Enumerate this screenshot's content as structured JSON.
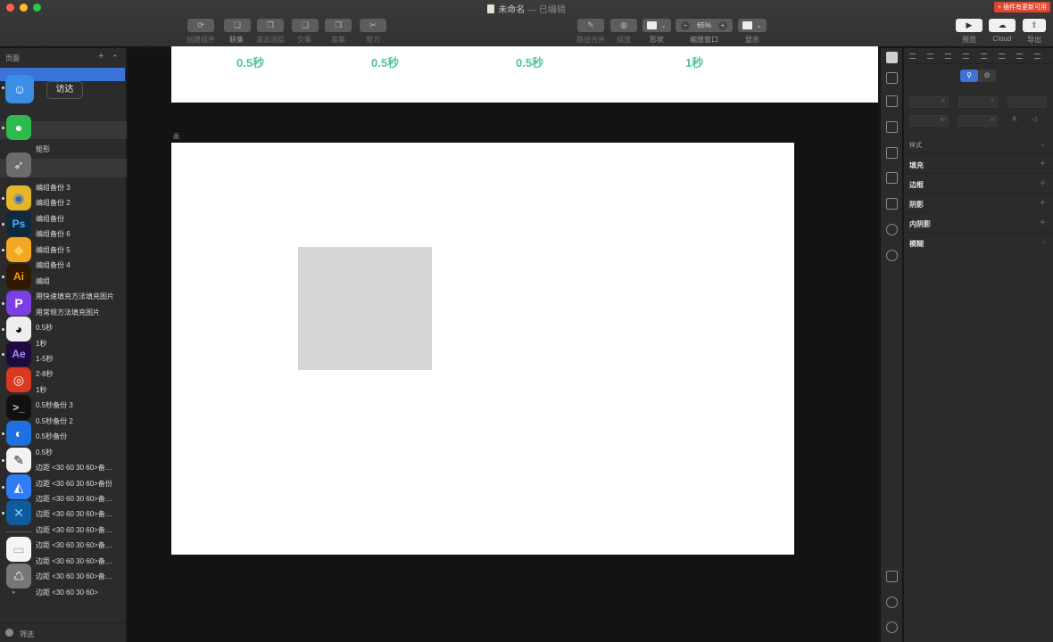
{
  "window": {
    "title": "未命名",
    "subtitle": "— 已编辑",
    "update_badge": "+ 插件有更新可用"
  },
  "toolbar": {
    "items": [
      {
        "label": "创建组件",
        "icon": "component-icon"
      },
      {
        "label": "联集",
        "icon": "union-icon"
      },
      {
        "label": "减去顶层",
        "icon": "subtract-icon"
      },
      {
        "label": "交集",
        "icon": "intersect-icon"
      },
      {
        "label": "差集",
        "icon": "difference-icon"
      },
      {
        "label": "剪刀",
        "icon": "scissors-icon"
      },
      {
        "label": "路径合并",
        "icon": "path-merge-icon"
      },
      {
        "label": "描放",
        "icon": "scale-icon"
      },
      {
        "label": "形状",
        "icon": "shape-icon"
      },
      {
        "label": "缩放窗口",
        "icon": "zoom-icon"
      },
      {
        "label": "显示",
        "icon": "view-icon"
      },
      {
        "label": "预览",
        "icon": "play-icon"
      },
      {
        "label": "Cloud",
        "icon": "cloud-icon"
      },
      {
        "label": "导出",
        "icon": "export-icon"
      }
    ],
    "zoom_value": "65%",
    "zoom_minus": "−",
    "zoom_plus": "+"
  },
  "layers_panel": {
    "title": "页面",
    "add": "+",
    "collapse": "⌃",
    "filter_label": "筛选",
    "rows": [
      "矩形",
      "编组备份 3",
      "编组备份 2",
      "编组备份",
      "编组备份 6",
      "编组备份 5",
      "编组备份 4",
      "编组",
      "用快速填充方法填充图片",
      "用常规方法填充图片",
      "0.5秒",
      "1秒",
      "1-5秒",
      "2-8秒",
      "1秒",
      "0.5秒备份 3",
      "0.5秒备份 2",
      "0.5秒备份",
      "0.5秒",
      "边距 <30 60 30 60>备…",
      "边距 <30 60 30 60>备份",
      "边距 <30 60 30 60>备…",
      "边距 <30 60 30 60>备…",
      "边距 <30 60 30 60>备…",
      "边距 <30 60 30 60>备…",
      "边距 <30 60 30 60>备…",
      "边距 <30 60 30 60>备…",
      "边距 <30 60 30 60>"
    ]
  },
  "dock": {
    "tooltip": "访达",
    "apps": [
      {
        "name": "finder-icon",
        "glyph": "☺",
        "bg": "#3a8ee6",
        "fg": "#fff"
      },
      {
        "name": "wechat-icon",
        "glyph": "●",
        "bg": "#2dbb4e",
        "fg": "#fff"
      },
      {
        "name": "launchpad-icon",
        "glyph": "➶",
        "bg": "#6c6c6c",
        "fg": "#ddd"
      },
      {
        "name": "chrome-icon",
        "glyph": "◉",
        "bg": "#e4b62a",
        "fg": "#2a66c9"
      },
      {
        "name": "photoshop-icon",
        "glyph": "Ps",
        "bg": "#0f2a3f",
        "fg": "#4fb0ff"
      },
      {
        "name": "sketch-icon",
        "glyph": "◆",
        "bg": "#f5a623",
        "fg": "#fbd15c"
      },
      {
        "name": "illustrator-icon",
        "glyph": "Ai",
        "bg": "#2e1a00",
        "fg": "#ff9a00"
      },
      {
        "name": "pixso-icon",
        "glyph": "P",
        "bg": "#7b3fe4",
        "fg": "#fff"
      },
      {
        "name": "qq-icon",
        "glyph": "◕",
        "bg": "#eeeeee",
        "fg": "#111"
      },
      {
        "name": "after-effects-icon",
        "glyph": "Ae",
        "bg": "#1f0a3f",
        "fg": "#b08cff"
      },
      {
        "name": "netease-music-icon",
        "glyph": "◎",
        "bg": "#d8391f",
        "fg": "#fff"
      },
      {
        "name": "terminal-icon",
        "glyph": ">_",
        "bg": "#111",
        "fg": "#ccc"
      },
      {
        "name": "browser-icon",
        "glyph": "◐",
        "bg": "#1e6fe0",
        "fg": "#fff"
      },
      {
        "name": "pen-app-icon",
        "glyph": "✎",
        "bg": "#f2f2f2",
        "fg": "#222"
      },
      {
        "name": "lanhu-icon",
        "glyph": "◭",
        "bg": "#2f7cf6",
        "fg": "#fff"
      },
      {
        "name": "xmind-icon",
        "glyph": "✕",
        "bg": "#0f5b9c",
        "fg": "#7fd1ff"
      },
      {
        "name": "document-icon",
        "glyph": "▭",
        "bg": "#f5f5f5",
        "fg": "#aaa"
      },
      {
        "name": "trash-icon",
        "glyph": "♺",
        "bg": "#777",
        "fg": "#ddd"
      }
    ]
  },
  "canvas": {
    "top_values": [
      "0.5秒",
      "0.5秒",
      "0.5秒",
      "1秒"
    ],
    "board_label": "画",
    "accent": "#52c3a0"
  },
  "inspector": {
    "mode_on": "⚲",
    "mode_off": "⚙",
    "fields": [
      "X",
      "Y",
      "",
      "W",
      "H"
    ],
    "style_label": "样式",
    "rows": [
      "填充",
      "边框",
      "阴影",
      "内阴影",
      "模糊"
    ],
    "add": "+"
  }
}
